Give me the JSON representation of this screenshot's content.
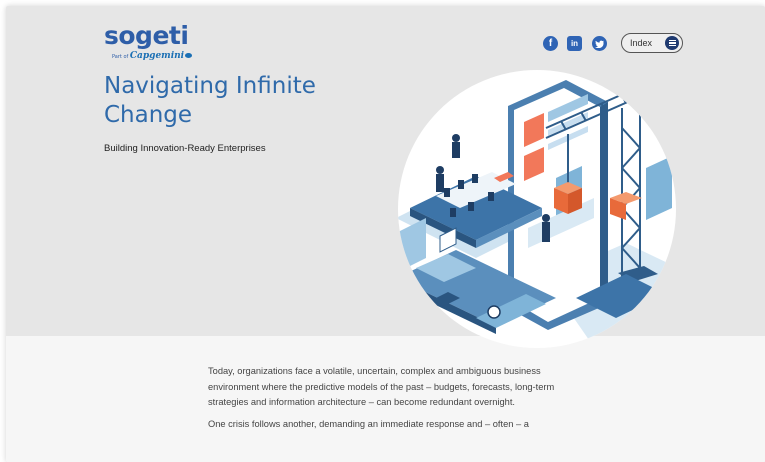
{
  "brand": {
    "name": "sogeti",
    "tagline_prefix": "Part of",
    "tagline_company": "Capgemini"
  },
  "header": {
    "social": {
      "facebook": "f",
      "linkedin": "in",
      "twitter": "twitter-bird"
    },
    "index_label": "Index",
    "index_icon": "menu-icon"
  },
  "hero": {
    "title": "Navigating Infinite Change",
    "subtitle": "Building Innovation-Ready Enterprises",
    "illustration": "isometric-city-smartphone-crane"
  },
  "body": {
    "paragraphs": [
      "Today, organizations face a volatile, uncertain, complex and ambiguous business environment where the predictive models of the past – budgets, forecasts, long-term strategies and information architecture – can become redundant overnight.",
      "One crisis follows another, demanding an immediate response and – often – a"
    ]
  },
  "colors": {
    "brand_blue": "#2e5ea8",
    "hero_bg": "#e6e6e6",
    "page_bg": "#f6f6f6",
    "accent_orange": "#e86a3a",
    "illus_blue": "#7fb4d8"
  }
}
